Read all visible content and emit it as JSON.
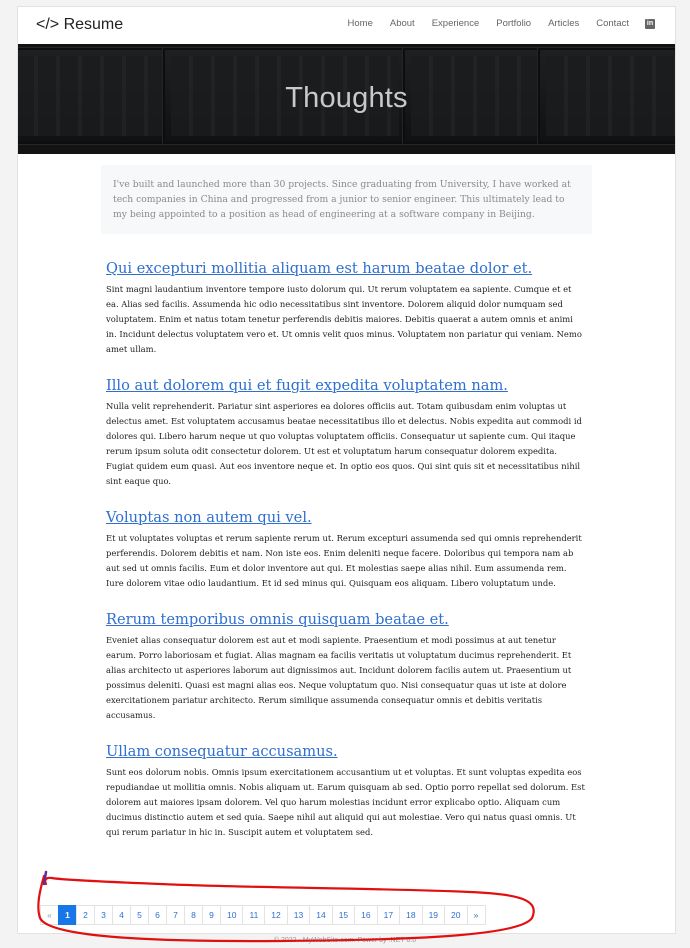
{
  "nav": {
    "brand": "</> Resume",
    "links": [
      "Home",
      "About",
      "Experience",
      "Portfolio",
      "Articles",
      "Contact"
    ],
    "linkedin_icon": "linkedin-icon"
  },
  "hero": {
    "title": "Thoughts"
  },
  "intro": "I've built and launched more than 30 projects. Since graduating from University, I have worked at tech companies in China and progressed from a junior to senior engineer. This ultimately lead to my being appointed to a position as head of engineering at a software company in Beijing.",
  "posts": [
    {
      "title": "Qui excepturi mollitia aliquam est harum beatae dolor et.",
      "body": "Sint magni laudantium inventore tempore iusto dolorum qui. Ut rerum voluptatem ea sapiente. Cumque et et ea. Alias sed facilis. Assumenda hic odio necessitatibus sint inventore. Dolorem aliquid dolor numquam sed voluptatem. Enim et natus totam tenetur perferendis debitis maiores. Debitis quaerat a autem omnis et animi in. Incidunt delectus voluptatem vero et. Ut omnis velit quos minus. Voluptatem non pariatur qui veniam. Nemo amet ullam."
    },
    {
      "title": "Illo aut dolorem qui et fugit expedita voluptatem nam.",
      "body": "Nulla velit reprehenderit. Pariatur sint asperiores ea dolores officiis aut. Totam quibusdam enim voluptas ut delectus amet. Est voluptatem accusamus beatae necessitatibus illo et delectus. Nobis expedita aut commodi id dolores qui. Libero harum neque ut quo voluptas voluptatem officiis. Consequatur ut sapiente cum. Qui itaque rerum ipsum soluta odit consectetur dolorem. Ut est et voluptatum harum consequatur dolorem expedita. Fugiat quidem eum quasi. Aut eos inventore neque et. In optio eos quos. Qui sint quis sit et necessitatibus nihil sint eaque quo."
    },
    {
      "title": "Voluptas non autem qui vel.",
      "body": "Et ut voluptates voluptas et rerum sapiente rerum ut. Rerum excepturi assumenda sed qui omnis reprehenderit perferendis. Dolorem debitis et nam. Non iste eos. Enim deleniti neque facere. Doloribus qui tempora nam ab aut sed ut omnis facilis. Eum et dolor inventore aut qui. Et molestias saepe alias nihil. Eum assumenda rem. Iure dolorem vitae odio laudantium. Et id sed minus qui. Quisquam eos aliquam. Libero voluptatum unde."
    },
    {
      "title": "Rerum temporibus omnis quisquam beatae et.",
      "body": "Eveniet alias consequatur dolorem est aut et modi sapiente. Praesentium et modi possimus at aut tenetur earum. Porro laboriosam et fugiat. Alias magnam ea facilis veritatis ut voluptatum ducimus reprehenderit. Et alias architecto ut asperiores laborum aut dignissimos aut. Incidunt dolorem facilis autem ut. Praesentium ut possimus deleniti. Quasi est magni alias eos. Neque voluptatum quo. Nisi consequatur quas ut iste at dolore exercitationem pariatur architecto. Rerum similique assumenda consequatur omnis et debitis veritatis accusamus."
    },
    {
      "title": "Ullam consequatur accusamus.",
      "body": "Sunt eos dolorum nobis. Omnis ipsum exercitationem accusantium ut et voluptas. Et sunt voluptas expedita eos repudiandae ut mollitia omnis. Nobis aliquam ut. Earum quisquam ab sed. Optio porro repellat sed dolorum. Est dolorem aut maiores ipsam dolorem. Vel quo harum molestias incidunt error explicabo optio. Aliquam cum ducimus distinctio autem et sed quia. Saepe nihil aut aliquid qui aut molestiae. Vero qui natus quasi omnis. Ut qui rerum pariatur in hic in. Suscipit autem et voluptatem sed."
    }
  ],
  "pagination": {
    "prev": "«",
    "pages": [
      "1",
      "2",
      "3",
      "4",
      "5",
      "6",
      "7",
      "8",
      "9",
      "10",
      "11",
      "12",
      "13",
      "14",
      "15",
      "16",
      "17",
      "18",
      "19",
      "20"
    ],
    "current": "1",
    "next": "»"
  },
  "footer": "© 2022 - MyWebSite.com. Power by .NET 6.0",
  "colors": {
    "link": "#2f6fd0",
    "active_page": "#1877e8",
    "annotation": "#e01010"
  }
}
